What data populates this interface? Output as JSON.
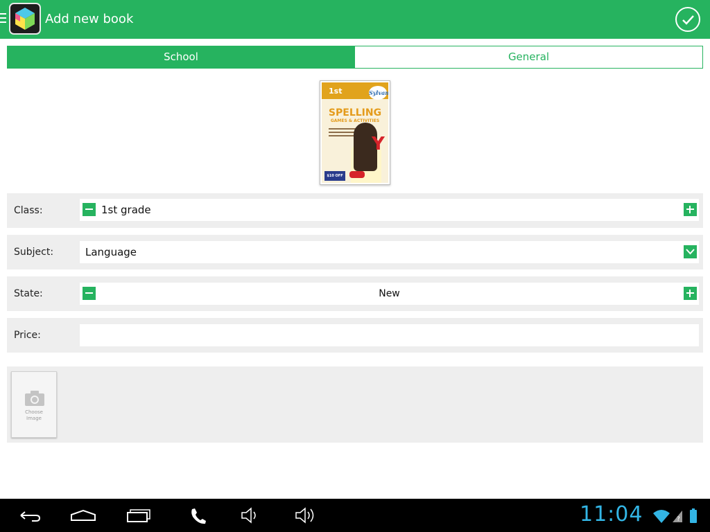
{
  "app_bar": {
    "title": "Add new book",
    "color": "#26b35f",
    "menu_icon": "hamburger-icon",
    "app_icon": "cube-app-icon",
    "confirm_icon": "check-circle-icon"
  },
  "tabs": [
    {
      "label": "School",
      "selected": true
    },
    {
      "label": "General",
      "selected": false
    }
  ],
  "book_cover": {
    "grade": "1st",
    "brand": "Sylvan",
    "title": "SPELLING",
    "subtitle": "GAMES & ACTIVITIES",
    "letter": "Y",
    "badge": "$10 OFF"
  },
  "form": {
    "class": {
      "label": "Class:",
      "value": "1st grade"
    },
    "subject": {
      "label": "Subject:",
      "value": "Language"
    },
    "state": {
      "label": "State:",
      "value": "New"
    },
    "price": {
      "label": "Price:",
      "value": ""
    }
  },
  "image_picker": {
    "label_line1": "Choose",
    "label_line2": "Image",
    "icon": "camera-icon"
  },
  "system_bar": {
    "time": "11:04",
    "time_color": "#33b5e5",
    "icons": [
      "back-icon",
      "home-icon",
      "recent-apps-icon",
      "phone-icon",
      "volume-down-icon",
      "volume-up-icon",
      "wifi-icon",
      "signal-icon",
      "battery-icon"
    ]
  }
}
